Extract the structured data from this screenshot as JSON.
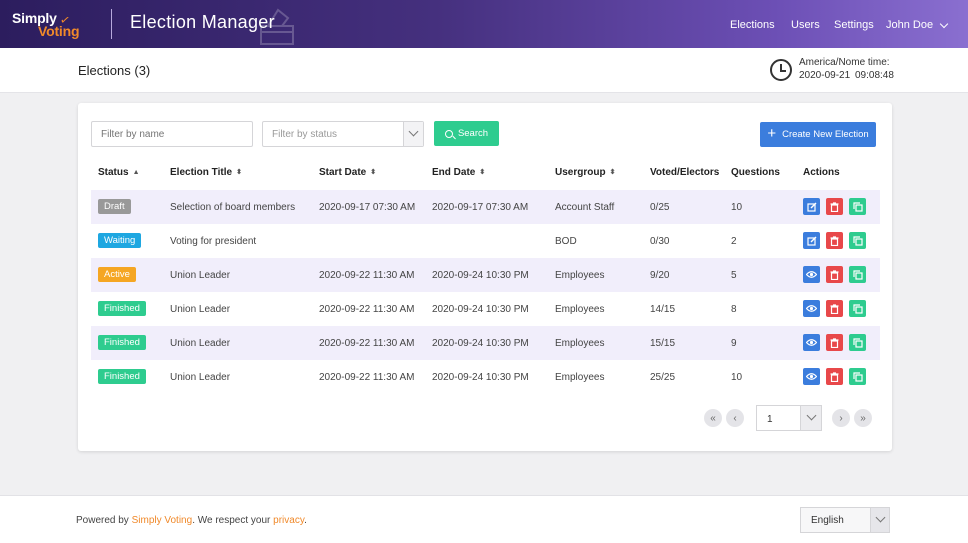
{
  "brand": {
    "logo_part1": "Simply",
    "logo_part2": "Voting",
    "app_title": "Election Manager"
  },
  "nav": {
    "elections": "Elections",
    "users": "Users",
    "settings": "Settings",
    "user": "John Doe"
  },
  "page": {
    "title": "Elections (3)"
  },
  "timezone": {
    "label": "America/Nome time:",
    "date": "2020-09-21",
    "time": "09:08:48"
  },
  "filters": {
    "name_placeholder": "Filter by name",
    "status_placeholder": "Filter by status",
    "search_label": "Search",
    "create_label": "Create New Election"
  },
  "columns": {
    "status": "Status",
    "title": "Election Title",
    "start": "Start Date",
    "end": "End Date",
    "usergroup": "Usergroup",
    "voted": "Voted/Electors",
    "questions": "Questions",
    "actions": "Actions"
  },
  "colors": {
    "draft": "#999999",
    "waiting": "#1ea7e1",
    "active": "#f5a623",
    "finished": "#2ecc8f",
    "header_start": "#2c1d5e",
    "header_end": "#8a6fd0",
    "accent_orange": "#f0892a"
  },
  "rows": [
    {
      "status": "Draft",
      "title": "Selection of board members",
      "start": "2020-09-17 07:30 AM",
      "end": "2020-09-17 07:30 AM",
      "usergroup": "Account Staff",
      "voted": "0/25",
      "questions": "10",
      "first_action_icon": "edit-icon"
    },
    {
      "status": "Waiting",
      "title": "Voting for president",
      "start": "",
      "end": "",
      "usergroup": "BOD",
      "voted": "0/30",
      "questions": "2",
      "first_action_icon": "edit-icon"
    },
    {
      "status": "Active",
      "title": "Union Leader",
      "start": "2020-09-22 11:30 AM",
      "end": "2020-09-24 10:30 PM",
      "usergroup": "Employees",
      "voted": "9/20",
      "questions": "5",
      "first_action_icon": "view-icon"
    },
    {
      "status": "Finished",
      "title": "Union Leader",
      "start": "2020-09-22 11:30 AM",
      "end": "2020-09-24 10:30 PM",
      "usergroup": "Employees",
      "voted": "14/15",
      "questions": "8",
      "first_action_icon": "view-icon"
    },
    {
      "status": "Finished",
      "title": "Union Leader",
      "start": "2020-09-22 11:30 AM",
      "end": "2020-09-24 10:30 PM",
      "usergroup": "Employees",
      "voted": "15/15",
      "questions": "9",
      "first_action_icon": "view-icon"
    },
    {
      "status": "Finished",
      "title": "Union Leader",
      "start": "2020-09-22 11:30 AM",
      "end": "2020-09-24 10:30 PM",
      "usergroup": "Employees",
      "voted": "25/25",
      "questions": "10",
      "first_action_icon": "view-icon"
    }
  ],
  "pagination": {
    "page": "1"
  },
  "footer": {
    "prefix": "Powered by ",
    "org": "Simply Voting",
    "middle": ". We respect your ",
    "privacy": "privacy",
    "suffix": ".",
    "language": "English"
  }
}
